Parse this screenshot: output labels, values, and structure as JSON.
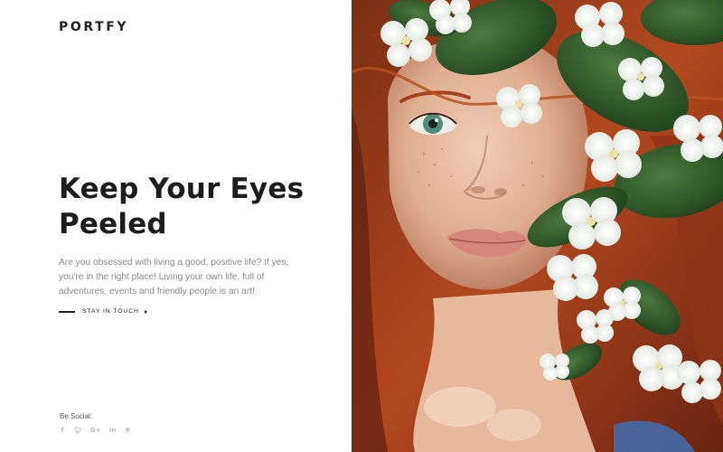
{
  "brand": {
    "logo": "PORTFY"
  },
  "hero": {
    "title": "Keep Your Eyes Peeled",
    "description": "Are you obsessed with living a good, positive life? If yes, you're in the right place! Living your own life, full of adventures, events and friendly people is an art!",
    "cta_label": "STAY IN TOUCH"
  },
  "social": {
    "label": "Be Social:",
    "icons": [
      {
        "name": "facebook-icon",
        "glyph": "f"
      },
      {
        "name": "twitter-icon",
        "glyph": "🐦︎"
      },
      {
        "name": "google-plus-icon",
        "glyph": "G+"
      },
      {
        "name": "linkedin-icon",
        "glyph": "in"
      },
      {
        "name": "pinterest-icon",
        "glyph": "℗"
      }
    ]
  },
  "photo": {
    "subject": "red-haired woman behind white jasmine flowers"
  },
  "colors": {
    "text_dark": "#1d1d1d",
    "text_muted": "#8a8a8a",
    "icon_muted": "#b8b8b8",
    "hair": "#a8401c",
    "leaf": "#2f5a2c",
    "petal": "#f4f6f2"
  }
}
